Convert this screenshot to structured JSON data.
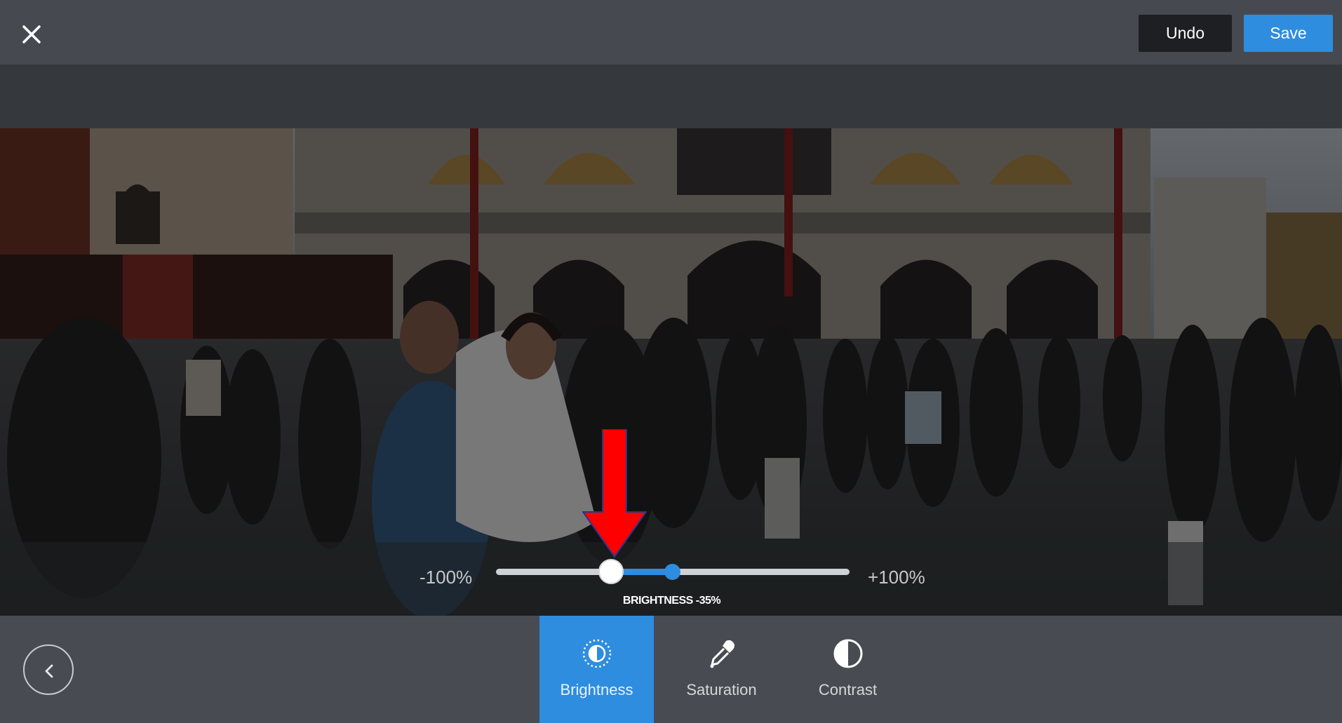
{
  "toolbar": {
    "close_icon": "close-icon",
    "undo_label": "Undo",
    "save_label": "Save"
  },
  "slider": {
    "min_label": "-100%",
    "max_label": "+100%",
    "value_percent": -35,
    "caption": "BRIGHTNESS -35%"
  },
  "tools": [
    {
      "label": "Brightness",
      "icon": "brightness-icon",
      "active": true
    },
    {
      "label": "Saturation",
      "icon": "eyedropper-icon",
      "active": false
    },
    {
      "label": "Contrast",
      "icon": "contrast-icon",
      "active": false
    }
  ],
  "colors": {
    "accent": "#2e8ddf",
    "topbar": "#464a50",
    "bottombar": "#484c52",
    "undo": "#1d1f22",
    "annotation_arrow": "#ff0000"
  }
}
